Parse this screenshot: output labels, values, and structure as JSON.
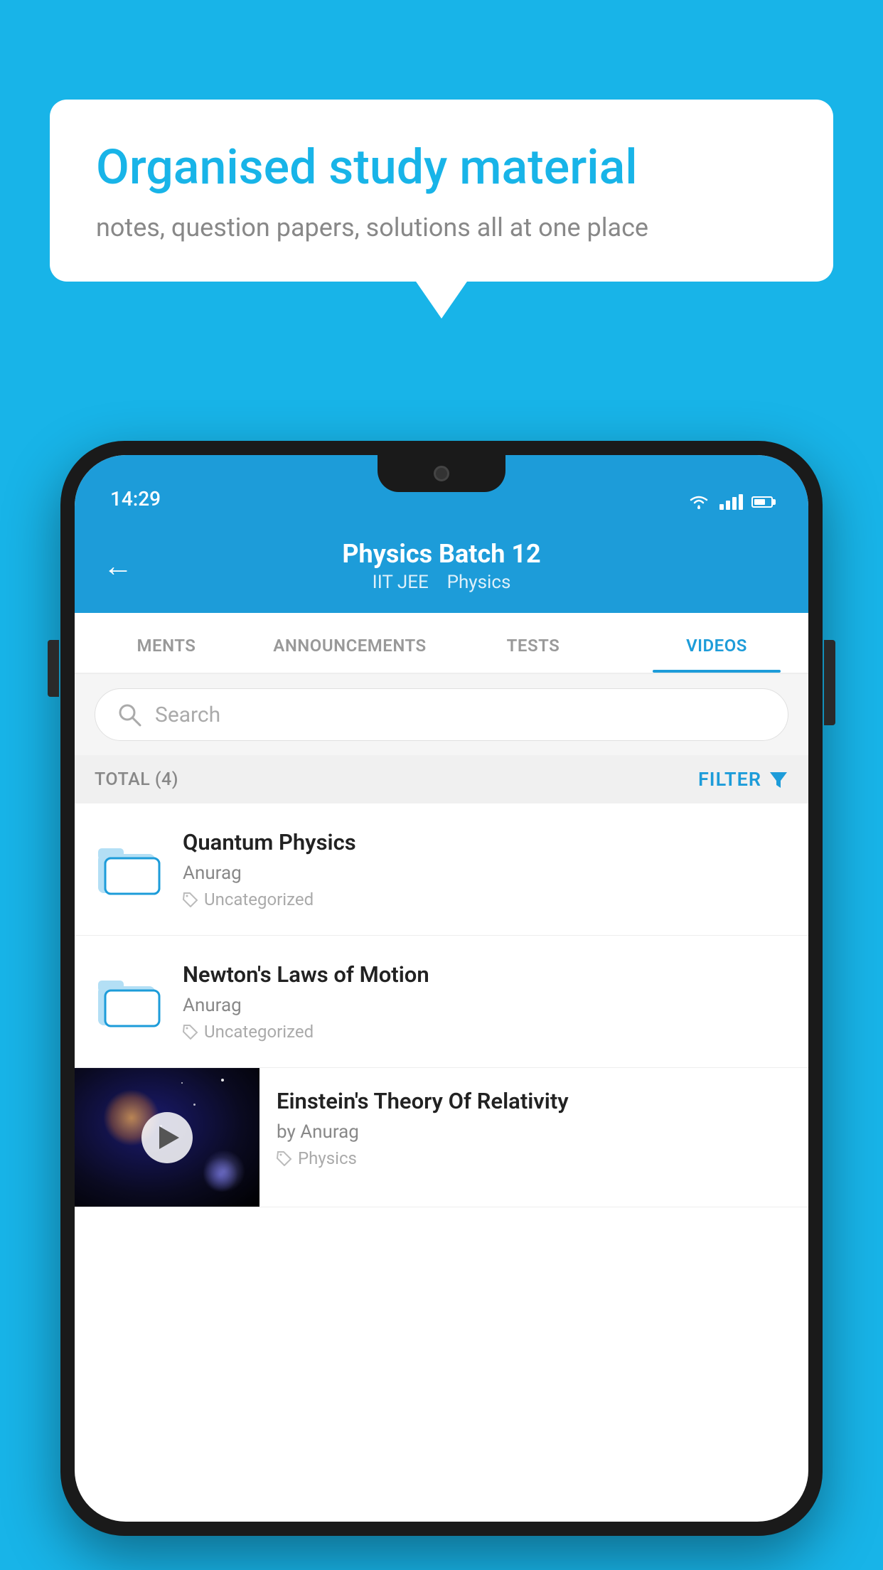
{
  "background": {
    "color": "#18b4e8"
  },
  "speech_bubble": {
    "title": "Organised study material",
    "subtitle": "notes, question papers, solutions all at one place"
  },
  "phone": {
    "status_bar": {
      "time": "14:29"
    },
    "header": {
      "back_label": "←",
      "title": "Physics Batch 12",
      "subtitle_tag1": "IIT JEE",
      "subtitle_tag2": "Physics"
    },
    "tabs": [
      {
        "label": "MENTS",
        "active": false
      },
      {
        "label": "ANNOUNCEMENTS",
        "active": false
      },
      {
        "label": "TESTS",
        "active": false
      },
      {
        "label": "VIDEOS",
        "active": true
      }
    ],
    "search": {
      "placeholder": "Search"
    },
    "filter_bar": {
      "total_label": "TOTAL (4)",
      "filter_label": "FILTER"
    },
    "videos": [
      {
        "title": "Quantum Physics",
        "author": "Anurag",
        "tag": "Uncategorized",
        "has_thumbnail": false
      },
      {
        "title": "Newton's Laws of Motion",
        "author": "Anurag",
        "tag": "Uncategorized",
        "has_thumbnail": false
      },
      {
        "title": "Einstein's Theory Of Relativity",
        "author": "by Anurag",
        "tag": "Physics",
        "has_thumbnail": true
      }
    ]
  }
}
